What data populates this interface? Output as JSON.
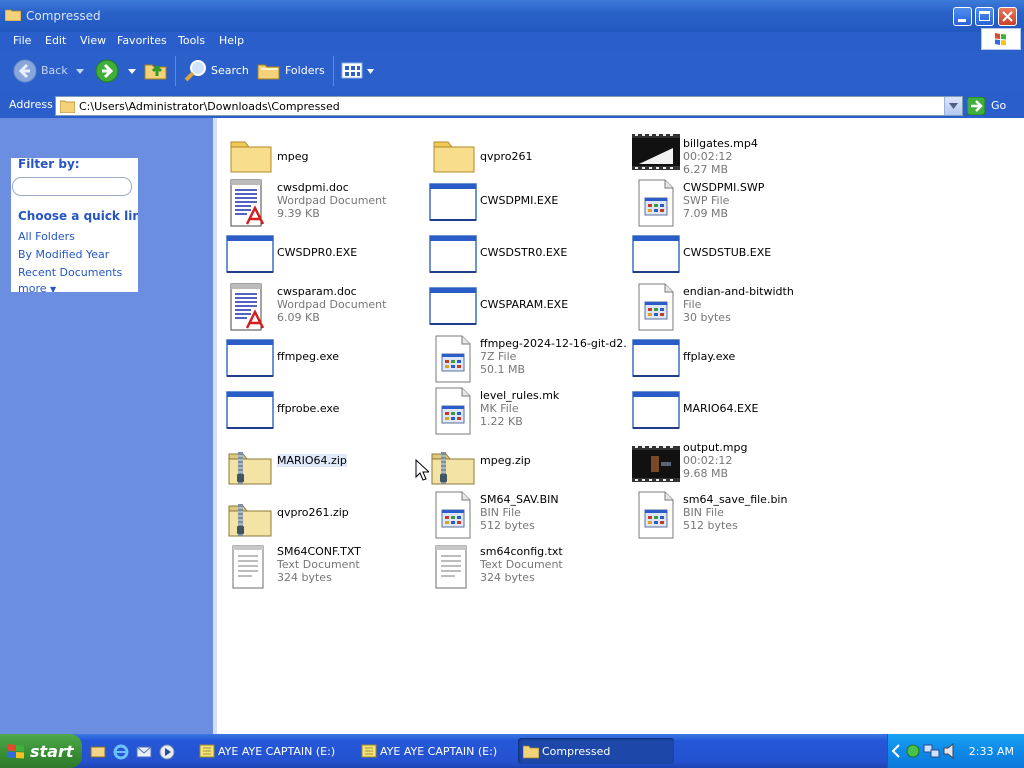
{
  "window": {
    "title": "Compressed"
  },
  "menu": [
    "File",
    "Edit",
    "View",
    "Favorites",
    "Tools",
    "Help"
  ],
  "toolbar": {
    "back": "Back",
    "search": "Search",
    "folders": "Folders"
  },
  "address": {
    "label": "Address",
    "path": "C:\\Users\\Administrator\\Downloads\\Compressed",
    "go": "Go"
  },
  "sidebar": {
    "filter_title": "Filter by:",
    "quick_title": "Choose a quick link:",
    "links": [
      "All Folders",
      "By Modified Year",
      "Recent Documents"
    ],
    "more": "more"
  },
  "files": [
    {
      "name": "mpeg",
      "type": "",
      "info": "",
      "icon": "folder-icon"
    },
    {
      "name": "qvpro261",
      "type": "",
      "info": "",
      "icon": "folder-icon"
    },
    {
      "name": "billgates.mp4",
      "type": "00:02:12",
      "info": "6.27 MB",
      "icon": "video-icon"
    },
    {
      "name": "cwsdpmi.doc",
      "type": "Wordpad Document",
      "info": "9.39 KB",
      "icon": "wordpad-icon"
    },
    {
      "name": "CWSDPMI.EXE",
      "type": "",
      "info": "",
      "icon": "exe-icon"
    },
    {
      "name": "CWSDPMI.SWP",
      "type": "SWP File",
      "info": "7.09 MB",
      "icon": "generic-file-icon"
    },
    {
      "name": "CWSDPR0.EXE",
      "type": "",
      "info": "",
      "icon": "exe-icon"
    },
    {
      "name": "CWSDSTR0.EXE",
      "type": "",
      "info": "",
      "icon": "exe-icon"
    },
    {
      "name": "CWSDSTUB.EXE",
      "type": "",
      "info": "",
      "icon": "exe-icon"
    },
    {
      "name": "cwsparam.doc",
      "type": "Wordpad Document",
      "info": "6.09 KB",
      "icon": "wordpad-icon"
    },
    {
      "name": "CWSPARAM.EXE",
      "type": "",
      "info": "",
      "icon": "exe-icon"
    },
    {
      "name": "endian-and-bitwidth",
      "type": "File",
      "info": "30 bytes",
      "icon": "generic-file-icon"
    },
    {
      "name": "ffmpeg.exe",
      "type": "",
      "info": "",
      "icon": "exe-icon"
    },
    {
      "name": "ffmpeg-2024-12-16-git-d2...",
      "type": "7Z File",
      "info": "50.1 MB",
      "icon": "generic-file-icon"
    },
    {
      "name": "ffplay.exe",
      "type": "",
      "info": "",
      "icon": "exe-icon"
    },
    {
      "name": "ffprobe.exe",
      "type": "",
      "info": "",
      "icon": "exe-icon"
    },
    {
      "name": "level_rules.mk",
      "type": "MK File",
      "info": "1.22 KB",
      "icon": "generic-file-icon"
    },
    {
      "name": "MARIO64.EXE",
      "type": "",
      "info": "",
      "icon": "exe-icon"
    },
    {
      "name": "MARIO64.zip",
      "type": "",
      "info": "",
      "icon": "zip-folder-icon"
    },
    {
      "name": "mpeg.zip",
      "type": "",
      "info": "",
      "icon": "zip-folder-icon"
    },
    {
      "name": "output.mpg",
      "type": "00:02:12",
      "info": "9.68 MB",
      "icon": "video-icon"
    },
    {
      "name": "qvpro261.zip",
      "type": "",
      "info": "",
      "icon": "zip-folder-icon"
    },
    {
      "name": "SM64_SAV.BIN",
      "type": "BIN File",
      "info": "512 bytes",
      "icon": "generic-file-icon"
    },
    {
      "name": "sm64_save_file.bin",
      "type": "BIN File",
      "info": "512 bytes",
      "icon": "generic-file-icon"
    },
    {
      "name": "SM64CONF.TXT",
      "type": "Text Document",
      "info": "324 bytes",
      "icon": "text-file-icon"
    },
    {
      "name": "sm64config.txt",
      "type": "Text Document",
      "info": "324 bytes",
      "icon": "text-file-icon"
    }
  ],
  "taskbar": {
    "start": "start",
    "tasks": [
      "AYE AYE CAPTAIN (E:)",
      "AYE AYE CAPTAIN (E:)",
      "Compressed"
    ],
    "clock": "2:33 AM"
  },
  "colors": {
    "title_blue": "#2a62c9",
    "sidebar_blue": "#6b8ee0",
    "link_blue": "#2556c3",
    "start_green": "#378c33",
    "tray_blue": "#0e8ae8"
  }
}
